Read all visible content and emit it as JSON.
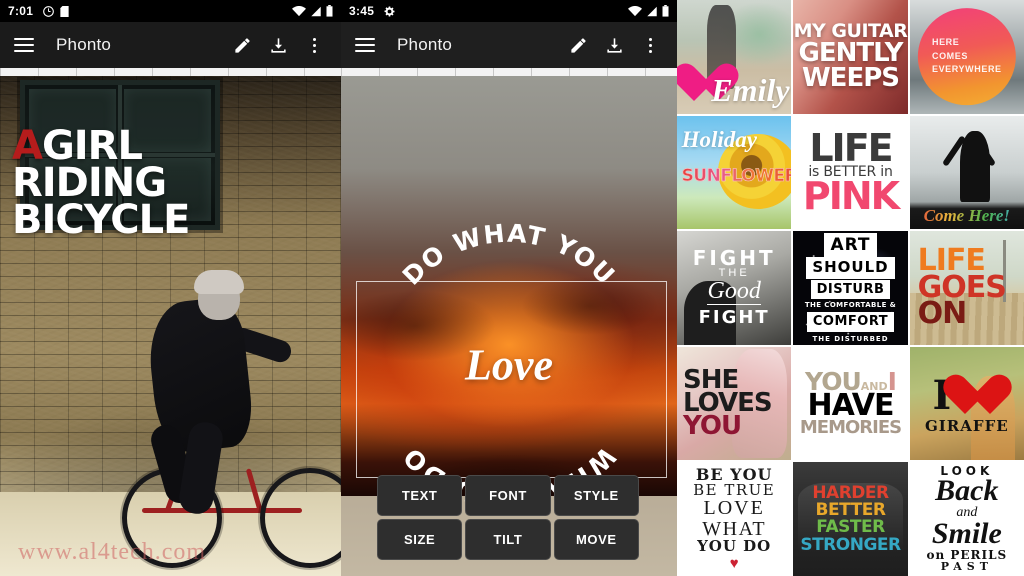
{
  "panel_left": {
    "status_bar": {
      "time": "7:01",
      "icons": [
        "alarm-icon",
        "sd-card-icon",
        "wifi-icon",
        "signal-icon",
        "battery-icon"
      ]
    },
    "app_bar": {
      "menu_icon": "hamburger-menu-icon",
      "title": "Phonto",
      "actions": [
        "pencil-edit-icon",
        "download-save-icon",
        "overflow-menu-icon"
      ]
    },
    "artwork": {
      "line1_accent": "A",
      "line1_rest": "GIRL",
      "line2": "RIDING",
      "line3": "BICYCLE",
      "accent_color": "#b51c1c",
      "text_color": "#ffffff",
      "watermark": "www.al4tech.com"
    }
  },
  "panel_middle": {
    "status_bar": {
      "time": "3:45",
      "icons": [
        "settings-gear-icon",
        "wifi-icon",
        "signal-icon",
        "battery-icon"
      ]
    },
    "app_bar": {
      "menu_icon": "hamburger-menu-icon",
      "title": "Phonto",
      "actions": [
        "pencil-edit-icon",
        "download-save-icon",
        "overflow-menu-icon"
      ]
    },
    "artwork": {
      "circle_text_top": "DO WHAT YOU",
      "circle_text_bottom": "WHAT YOU DO",
      "circle_text_full": "DO WHAT YOU DO WHAT YOU DO",
      "center_script": "Love"
    },
    "toolbar_buttons": [
      "TEXT",
      "FONT",
      "STYLE",
      "SIZE",
      "TILT",
      "MOVE"
    ]
  },
  "gallery": {
    "items": [
      {
        "id": "emily",
        "caption": "Emily",
        "lines": [
          "Emily"
        ]
      },
      {
        "id": "guitar",
        "caption": "MY GUITAR GENTLY WEEPS",
        "lines": [
          "MY GUITAR",
          "GENTLY",
          "WEEPS"
        ]
      },
      {
        "id": "here-comes",
        "caption": "HERE COMES EVERYWHERE",
        "lines": [
          "HERE",
          "COMES",
          "EVERYWHERE"
        ]
      },
      {
        "id": "sunflower",
        "caption": "Holiday SUNFLOWER",
        "lines": [
          "Holiday",
          "SUNFLOWER"
        ]
      },
      {
        "id": "life-pink",
        "caption": "LIFE is BETTER in PINK",
        "lines": [
          "LIFE",
          "is BETTER in",
          "PINK"
        ]
      },
      {
        "id": "come-here",
        "caption": "Come Here!",
        "lines": [
          "Come Here!"
        ]
      },
      {
        "id": "fight-good",
        "caption": "FIGHT THE Good FIGHT",
        "lines": [
          "FIGHT",
          "THE",
          "Good",
          "FIGHT"
        ]
      },
      {
        "id": "art-disturb",
        "caption": "ART SHOULD DISTURB THE COMFORTABLE & COMFORT THE DISTURBED",
        "lines": [
          "ART",
          "SHOULD",
          "DISTURB",
          "THE COMFORTABLE &",
          "COMFORT",
          "THE DISTURBED"
        ]
      },
      {
        "id": "life-goes-on",
        "caption": "LIFE GOES ON",
        "lines": [
          "LIFE",
          "GOES",
          "ON"
        ]
      },
      {
        "id": "she-loves",
        "caption": "SHE LOVES YOU",
        "lines": [
          "SHE",
          "LOVES",
          "YOU"
        ]
      },
      {
        "id": "memories",
        "caption": "YOU AND I HAVE MEMORIES",
        "lines": [
          "YOU",
          "AND",
          "I",
          "HAVE",
          "MEMORIES"
        ]
      },
      {
        "id": "giraffe",
        "caption": "I LOVE GIRAFFE",
        "lines": [
          "I",
          "GIRAFFE"
        ]
      },
      {
        "id": "be-you",
        "caption": "BE YOU BE TRUE LOVE WHAT YOU DO",
        "lines": [
          "BE YOU",
          "BE TRUE",
          "LOVE",
          "WHAT",
          "YOU DO",
          "♥"
        ]
      },
      {
        "id": "harder",
        "caption": "HARDER BETTER FASTER STRONGER",
        "lines": [
          "HARDER",
          "BETTER",
          "FASTER",
          "STRONGER"
        ]
      },
      {
        "id": "look-back",
        "caption": "LOOK Back and Smile on PERILS PAST",
        "lines": [
          "LOOK",
          "Back",
          "and",
          "Smile",
          "on PERILS",
          "PAST"
        ]
      }
    ]
  },
  "colors": {
    "status_bar_bg": "#000000",
    "app_bar_bg": "#1b1b1b",
    "tool_button_bg": "#2e2e2e",
    "accent_red": "#b51c1c",
    "accent_pink": "#f1486f"
  }
}
